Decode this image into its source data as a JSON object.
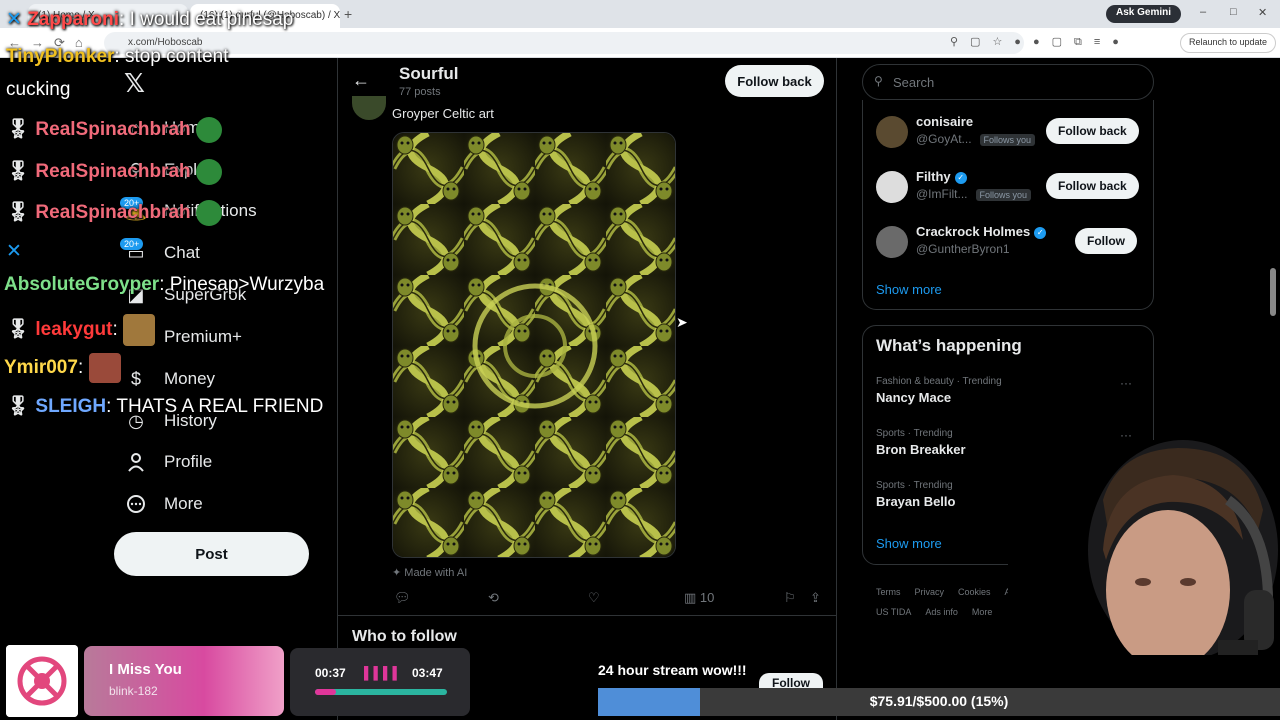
{
  "browser": {
    "tabs": [
      "(1) Home / X",
      "(16) (1) ourful (@Hoboscab) / X"
    ],
    "url": "x.com/Hoboscab",
    "ask_gemini": "Ask Gemini",
    "relaunch": "Relaunch to update"
  },
  "nav": {
    "items": [
      "Home",
      "Explore",
      "Notifications",
      "Chat",
      "SuperGrok",
      "Premium+",
      "Money",
      "History",
      "Profile",
      "More"
    ],
    "badges": [
      "20+",
      "20+"
    ],
    "post_label": "Post"
  },
  "chat": [
    {
      "user": "Zapparoni",
      "message": ": I would eat pinesap",
      "color": "#ff4a4a"
    },
    {
      "user": "TinyPlonker",
      "message": ": stop content",
      "color": "#f0c020"
    },
    {
      "user": "",
      "message": "cucking",
      "color": "#ffffff"
    },
    {
      "user": "RealSpinachbrah",
      "message": "",
      "color": "#f06a7a"
    },
    {
      "user": "RealSpinachbrah",
      "message": "",
      "color": "#f06a7a"
    },
    {
      "user": "RealSpinachbrah",
      "message": "",
      "color": "#f06a7a"
    },
    {
      "user": "AbsoluteGroyper",
      "message": ": Pinesap>Wurzyba",
      "color": "#7ee08a"
    },
    {
      "user": "leakygut",
      "message": ":",
      "color": "#ff3a3a"
    },
    {
      "user": "Ymir007",
      "message": ":",
      "color": "#ffd84a"
    },
    {
      "user": "SLEIGH",
      "message": ": THATS A REAL FRIEND",
      "color": "#6fa8ff"
    }
  ],
  "profile": {
    "name": "Sourful",
    "posts": "77 posts",
    "follow_back": "Follow back"
  },
  "tweet": {
    "text": "Groyper Celtic art",
    "ai_label": "Made with AI",
    "views": "10"
  },
  "who_to_follow_title": "Who to follow",
  "search_placeholder": "Search",
  "suggestions": [
    {
      "name": "conisaire",
      "handle": "@GoyAt...",
      "follows_you": "Follows you",
      "button": "Follow back",
      "verified": false
    },
    {
      "name": "Filthy",
      "handle": "@ImFilt...",
      "follows_you": "Follows you",
      "button": "Follow back",
      "verified": true
    },
    {
      "name": "Crackrock Holmes",
      "handle": "@GuntherByron1",
      "follows_you": "",
      "button": "Follow",
      "verified": true
    }
  ],
  "show_more": "Show more",
  "whats_happening": {
    "title": "What’s happening",
    "trends": [
      {
        "meta": "Fashion & beauty · Trending",
        "name": "Nancy Mace"
      },
      {
        "meta": "Sports · Trending",
        "name": "Bron Breakker"
      },
      {
        "meta": "Sports · Trending",
        "name": "Brayan Bello"
      }
    ],
    "show_more": "Show more"
  },
  "footer": [
    "Terms",
    "Privacy",
    "Cookies",
    "Ac",
    "US TIDA",
    "Ads info",
    "More"
  ],
  "now_playing": {
    "title": "I Miss You",
    "artist": "blink-182",
    "elapsed": "00:37",
    "total": "03:47",
    "progress": 0.16
  },
  "stream": {
    "message": "24 hour stream wow!!!",
    "follow": "Follow",
    "goal_text": "$75.91/$500.00 (15%)",
    "goal_progress": 0.15
  },
  "colors": {
    "accent": "#1d9bf0",
    "background": "#000000",
    "border": "#2f3336"
  }
}
